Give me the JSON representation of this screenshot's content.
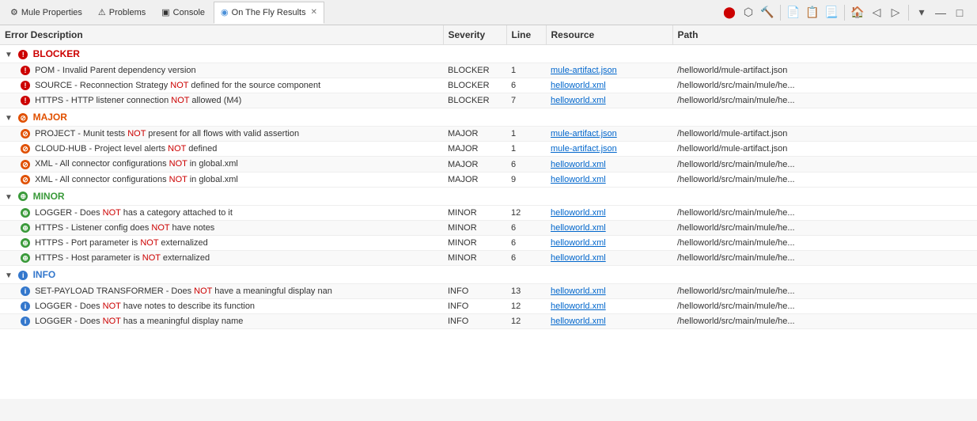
{
  "toolbar": {
    "tabs": [
      {
        "id": "mule-properties",
        "label": "Mule Properties",
        "icon": "⚙",
        "active": false
      },
      {
        "id": "problems",
        "label": "Problems",
        "icon": "⚠",
        "active": false
      },
      {
        "id": "console",
        "label": "Console",
        "icon": "🖥",
        "active": false
      },
      {
        "id": "on-the-fly",
        "label": "On The Fly Results",
        "icon": "◉",
        "active": true,
        "closable": true
      }
    ],
    "right_icons": [
      "stop",
      "record",
      "hammer",
      "separator",
      "doc",
      "doc2",
      "doc3",
      "separator2",
      "home",
      "back",
      "forward",
      "separator3",
      "more",
      "minimize",
      "maximize"
    ]
  },
  "table": {
    "columns": [
      {
        "id": "error",
        "label": "Error Description"
      },
      {
        "id": "severity",
        "label": "Severity"
      },
      {
        "id": "line",
        "label": "Line"
      },
      {
        "id": "resource",
        "label": "Resource"
      },
      {
        "id": "path",
        "label": "Path"
      }
    ],
    "categories": [
      {
        "id": "blocker",
        "label": "BLOCKER",
        "icon_type": "blocker",
        "items": [
          {
            "description": "POM - Invalid Parent dependency version",
            "severity": "BLOCKER",
            "line": "1",
            "resource": "mule-artifact.json",
            "path": "/helloworld/mule-artifact.json",
            "icon_type": "blocker"
          },
          {
            "description": "SOURCE - Reconnection Strategy NOT defined for the source component",
            "severity": "BLOCKER",
            "line": "6",
            "resource": "helloworld.xml",
            "path": "/helloworld/src/main/mule/he...",
            "icon_type": "blocker"
          },
          {
            "description": "HTTPS - HTTP listener connection NOT allowed (M4)",
            "severity": "BLOCKER",
            "line": "7",
            "resource": "helloworld.xml",
            "path": "/helloworld/src/main/mule/he...",
            "icon_type": "blocker"
          }
        ]
      },
      {
        "id": "major",
        "label": "MAJOR",
        "icon_type": "major",
        "items": [
          {
            "description": "PROJECT - Munit tests NOT present for all flows with valid assertion",
            "severity": "MAJOR",
            "line": "1",
            "resource": "mule-artifact.json",
            "path": "/helloworld/mule-artifact.json",
            "icon_type": "major"
          },
          {
            "description": "CLOUD-HUB - Project level alerts NOT defined",
            "severity": "MAJOR",
            "line": "1",
            "resource": "mule-artifact.json",
            "path": "/helloworld/mule-artifact.json",
            "icon_type": "major"
          },
          {
            "description": "XML - All connector configurations NOT in global.xml",
            "severity": "MAJOR",
            "line": "6",
            "resource": "helloworld.xml",
            "path": "/helloworld/src/main/mule/he...",
            "icon_type": "major"
          },
          {
            "description": "XML - All connector configurations NOT in global.xml",
            "severity": "MAJOR",
            "line": "9",
            "resource": "helloworld.xml",
            "path": "/helloworld/src/main/mule/he...",
            "icon_type": "major"
          }
        ]
      },
      {
        "id": "minor",
        "label": "MINOR",
        "icon_type": "minor",
        "items": [
          {
            "description": "LOGGER - Does NOT has a category attached to it",
            "severity": "MINOR",
            "line": "12",
            "resource": "helloworld.xml",
            "path": "/helloworld/src/main/mule/he...",
            "icon_type": "minor"
          },
          {
            "description": "HTTPS - Listener config does NOT have notes",
            "severity": "MINOR",
            "line": "6",
            "resource": "helloworld.xml",
            "path": "/helloworld/src/main/mule/he...",
            "icon_type": "minor"
          },
          {
            "description": "HTTPS - Port parameter is NOT externalized",
            "severity": "MINOR",
            "line": "6",
            "resource": "helloworld.xml",
            "path": "/helloworld/src/main/mule/he...",
            "icon_type": "minor"
          },
          {
            "description": "HTTPS - Host parameter is NOT externalized",
            "severity": "MINOR",
            "line": "6",
            "resource": "helloworld.xml",
            "path": "/helloworld/src/main/mule/he...",
            "icon_type": "minor"
          }
        ]
      },
      {
        "id": "info",
        "label": "INFO",
        "icon_type": "info",
        "items": [
          {
            "description": "SET-PAYLOAD TRANSFORMER - Does NOT have a meaningful display nan",
            "severity": "INFO",
            "line": "13",
            "resource": "helloworld.xml",
            "path": "/helloworld/src/main/mule/he...",
            "icon_type": "info"
          },
          {
            "description": "LOGGER - Does NOT have notes to describe its function",
            "severity": "INFO",
            "line": "12",
            "resource": "helloworld.xml",
            "path": "/helloworld/src/main/mule/he...",
            "icon_type": "info"
          },
          {
            "description": "LOGGER - Does NOT has a meaningful display name",
            "severity": "INFO",
            "line": "12",
            "resource": "helloworld.xml",
            "path": "/helloworld/src/main/mule/he...",
            "icon_type": "info"
          }
        ]
      }
    ]
  },
  "colors": {
    "blocker": "#cc0000",
    "major": "#e05000",
    "minor": "#3a9a3a",
    "info": "#3377cc",
    "accent": "#4a90d9"
  }
}
